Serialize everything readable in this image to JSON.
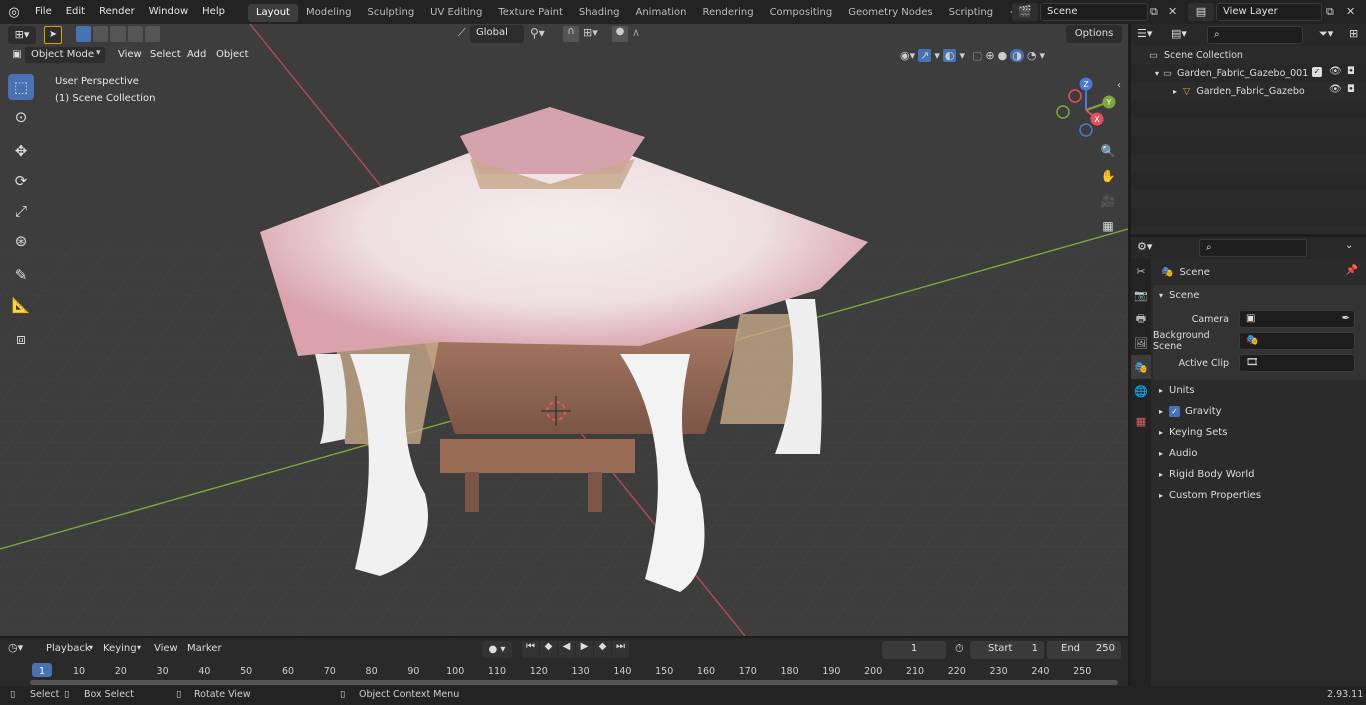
{
  "menus": [
    "File",
    "Edit",
    "Render",
    "Window",
    "Help"
  ],
  "workspaces": [
    "Layout",
    "Modeling",
    "Sculpting",
    "UV Editing",
    "Texture Paint",
    "Shading",
    "Animation",
    "Rendering",
    "Compositing",
    "Geometry Nodes",
    "Scripting"
  ],
  "active_workspace": "Layout",
  "add_workspace": "+",
  "scene_field": "Scene",
  "view_layer_field": "View Layer",
  "viewport": {
    "mode": "Object Mode",
    "menu": [
      "View",
      "Select",
      "Add",
      "Object"
    ],
    "orientation": "Global",
    "options": "Options",
    "overlay_line1": "User Perspective",
    "overlay_line2": "(1) Scene Collection",
    "gizmo": {
      "x": "X",
      "y": "Y",
      "z": "Z"
    }
  },
  "outliner": {
    "root": "Scene Collection",
    "collection": "Garden_Fabric_Gazebo_001",
    "object": "Garden_Fabric_Gazebo"
  },
  "properties": {
    "header": "Scene",
    "panel": "Scene",
    "fields": [
      {
        "label": "Camera"
      },
      {
        "label": "Background Scene"
      },
      {
        "label": "Active Clip"
      }
    ],
    "sections": [
      "Units",
      "Gravity",
      "Keying Sets",
      "Audio",
      "Rigid Body World",
      "Custom Properties"
    ]
  },
  "timeline": {
    "menus": [
      "Playback",
      "Keying",
      "View",
      "Marker"
    ],
    "current_frame": "1",
    "start_label": "Start",
    "start": "1",
    "end_label": "End",
    "end": "250",
    "ticks": [
      "1",
      "10",
      "20",
      "30",
      "40",
      "50",
      "60",
      "70",
      "80",
      "90",
      "100",
      "110",
      "120",
      "130",
      "140",
      "150",
      "160",
      "170",
      "180",
      "190",
      "200",
      "210",
      "220",
      "230",
      "240",
      "250"
    ]
  },
  "status": {
    "select": "Select",
    "box_select": "Box Select",
    "rotate_view": "Rotate View",
    "context_menu": "Object Context Menu",
    "version": "2.93.11"
  },
  "colors": {
    "accent": "#4772b3",
    "x_axis": "#b24a5a",
    "y_axis": "#7fa83a"
  }
}
